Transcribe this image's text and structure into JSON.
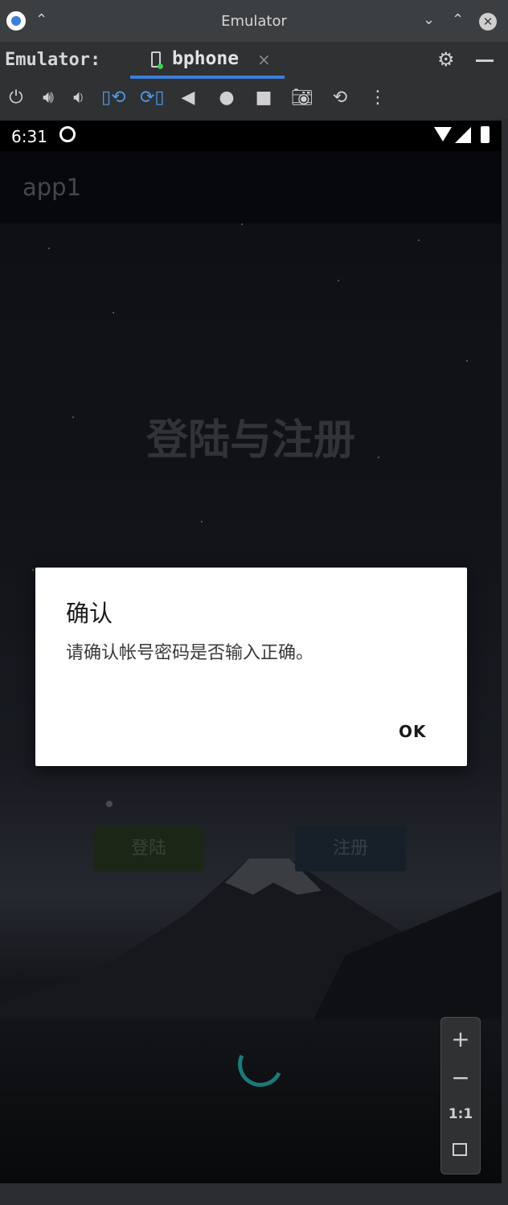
{
  "window": {
    "title": "Emulator"
  },
  "toolwindow": {
    "label": "Emulator:",
    "tab_name": "bphone",
    "tab_close": "×"
  },
  "toolbar": {
    "icons": [
      "power-icon",
      "volume-up-icon",
      "volume-down-icon",
      "rotate-left-icon",
      "rotate-right-icon",
      "back-icon",
      "home-icon",
      "overview-icon",
      "screenshot-icon",
      "snapshot-icon",
      "more-icon"
    ]
  },
  "device": {
    "status_time": "6:31"
  },
  "app": {
    "title": "app1",
    "heading": "登陆与注册",
    "login_button": "登陆",
    "register_button": "注册"
  },
  "dialog": {
    "title": "确认",
    "message": "请确认帐号密码是否输入正确。",
    "ok_button": "OK"
  },
  "zoom": {
    "plus": "+",
    "minus": "−",
    "actual": "1:1"
  },
  "colors": {
    "accent": "#3d7fd9",
    "spinner": "#1b7a78",
    "dialog_bg": "#ffffff"
  }
}
